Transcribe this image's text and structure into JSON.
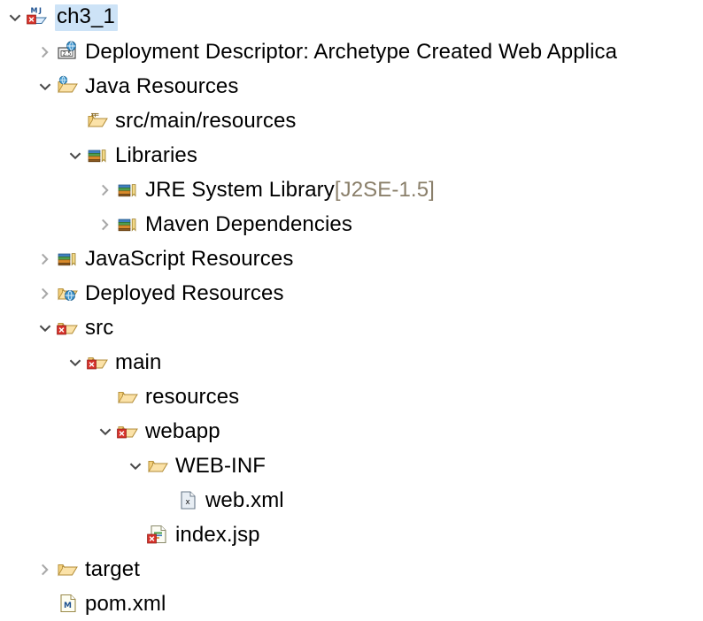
{
  "view": {
    "name": "project-explorer",
    "background": "#ffffff",
    "selection_color": "#cde3f7",
    "text_color": "#000000",
    "dim_text_color": "#8a7f6a",
    "twisty_color": "#a8a8a8"
  },
  "tree": {
    "nodes": [
      {
        "id": "ch3_1",
        "label": "ch3_1",
        "suffix": "",
        "depth": 0,
        "state": "expanded",
        "icon": "maven-web-project-icon",
        "error": true,
        "selected": true
      },
      {
        "id": "deployment-descriptor",
        "label": "Deployment Descriptor: Archetype Created Web Applica",
        "suffix": "",
        "depth": 1,
        "state": "collapsed",
        "icon": "deployment-descriptor-icon",
        "error": false,
        "selected": false
      },
      {
        "id": "java-resources",
        "label": "Java Resources",
        "suffix": "",
        "depth": 1,
        "state": "expanded",
        "icon": "java-resources-icon",
        "error": false,
        "selected": false
      },
      {
        "id": "src-main-resources",
        "label": "src/main/resources",
        "suffix": "",
        "depth": 2,
        "state": "none",
        "icon": "source-folder-icon",
        "error": false,
        "selected": false
      },
      {
        "id": "libraries",
        "label": "Libraries",
        "suffix": "",
        "depth": 2,
        "state": "expanded",
        "icon": "library-icon",
        "error": false,
        "selected": false
      },
      {
        "id": "jre-system-library",
        "label": "JRE System Library ",
        "suffix": "[J2SE-1.5]",
        "depth": 3,
        "state": "collapsed",
        "icon": "library-icon",
        "error": false,
        "selected": false
      },
      {
        "id": "maven-dependencies",
        "label": "Maven Dependencies",
        "suffix": "",
        "depth": 3,
        "state": "collapsed",
        "icon": "library-icon",
        "error": false,
        "selected": false
      },
      {
        "id": "javascript-resources",
        "label": "JavaScript Resources",
        "suffix": "",
        "depth": 1,
        "state": "collapsed",
        "icon": "library-icon",
        "error": false,
        "selected": false
      },
      {
        "id": "deployed-resources",
        "label": "Deployed Resources",
        "suffix": "",
        "depth": 1,
        "state": "collapsed",
        "icon": "deployed-resources-icon",
        "error": false,
        "selected": false
      },
      {
        "id": "src",
        "label": "src",
        "suffix": "",
        "depth": 1,
        "state": "expanded",
        "icon": "folder-icon",
        "error": true,
        "selected": false
      },
      {
        "id": "main",
        "label": "main",
        "suffix": "",
        "depth": 2,
        "state": "expanded",
        "icon": "folder-icon",
        "error": true,
        "selected": false
      },
      {
        "id": "resources",
        "label": "resources",
        "suffix": "",
        "depth": 3,
        "state": "none",
        "icon": "folder-icon",
        "error": false,
        "selected": false
      },
      {
        "id": "webapp",
        "label": "webapp",
        "suffix": "",
        "depth": 3,
        "state": "expanded",
        "icon": "folder-icon",
        "error": true,
        "selected": false
      },
      {
        "id": "web-inf",
        "label": "WEB-INF",
        "suffix": "",
        "depth": 4,
        "state": "expanded",
        "icon": "folder-icon",
        "error": false,
        "selected": false
      },
      {
        "id": "web-xml",
        "label": "web.xml",
        "suffix": "",
        "depth": 5,
        "state": "none",
        "icon": "xml-file-icon",
        "error": false,
        "selected": false
      },
      {
        "id": "index-jsp",
        "label": "index.jsp",
        "suffix": "",
        "depth": 4,
        "state": "none",
        "icon": "jsp-file-icon",
        "error": true,
        "selected": false
      },
      {
        "id": "target",
        "label": "target",
        "suffix": "",
        "depth": 1,
        "state": "collapsed",
        "icon": "folder-icon",
        "error": false,
        "selected": false
      },
      {
        "id": "pom-xml",
        "label": "pom.xml",
        "suffix": "",
        "depth": 1,
        "state": "none",
        "icon": "maven-pom-icon",
        "error": false,
        "selected": false
      }
    ]
  },
  "icons": {
    "maven-web-project-icon": "maven-web-project-icon",
    "deployment-descriptor-icon": "deployment-descriptor-icon",
    "java-resources-icon": "java-resources-icon",
    "source-folder-icon": "source-folder-icon",
    "library-icon": "library-icon",
    "deployed-resources-icon": "deployed-resources-icon",
    "folder-icon": "folder-icon",
    "xml-file-icon": "xml-file-icon",
    "jsp-file-icon": "jsp-file-icon",
    "maven-pom-icon": "maven-pom-icon",
    "chevron-right-icon": "chevron-right-icon",
    "chevron-down-icon": "chevron-down-icon",
    "error-badge-icon": "error-badge-icon"
  },
  "badge": {
    "deployment_descriptor_version": "2.5",
    "maven_letter": "M",
    "java_letter": "J",
    "xml_letter": "x",
    "pom_letter": "M"
  }
}
